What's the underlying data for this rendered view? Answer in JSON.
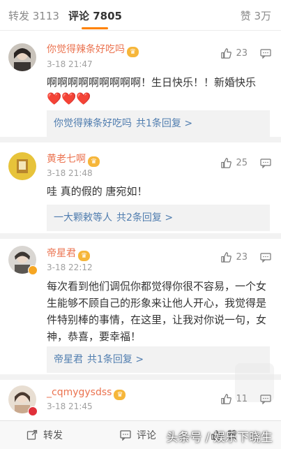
{
  "tabs": {
    "repost": "转发 3113",
    "comment": "评论 7805",
    "like": "赞 3万"
  },
  "comments": [
    {
      "username": "你觉得辣条好吃吗",
      "time": "3-18 21:47",
      "likes": "23",
      "text": "啊啊啊啊啊啊啊啊啊！生日快乐！！新婚快乐",
      "hearts": "❤️❤️❤️",
      "reply_name": "你觉得辣条好吃吗",
      "reply_count": "共1条回复 >"
    },
    {
      "username": "黄老七啊",
      "time": "3-18 21:48",
      "likes": "25",
      "text": "哇 真的假的 唐宛如！",
      "reply_name": "一大颗敕等人",
      "reply_count": "共2条回复 >"
    },
    {
      "username": "帝星君",
      "time": "3-18 22:12",
      "likes": "23",
      "text": "每次看到他们调侃你都觉得你很不容易，一个女生能够不顾自己的形象来让他人开心，我觉得是件特别棒的事情，在这里，让我对你说一句，女神，恭喜，要幸福！",
      "reply_name": "帝星君",
      "reply_count": "共1条回复 >"
    },
    {
      "username": "_cqmygysdss",
      "time": "3-18 21:45",
      "likes": "11"
    }
  ],
  "bottom": {
    "repost": "转发",
    "comment": "评论",
    "like": "赞"
  },
  "watermark": "头条号 / 娱乐下晓生",
  "colors": {
    "accent": "#ff8200",
    "username": "#eb7350",
    "link": "#507daf"
  }
}
